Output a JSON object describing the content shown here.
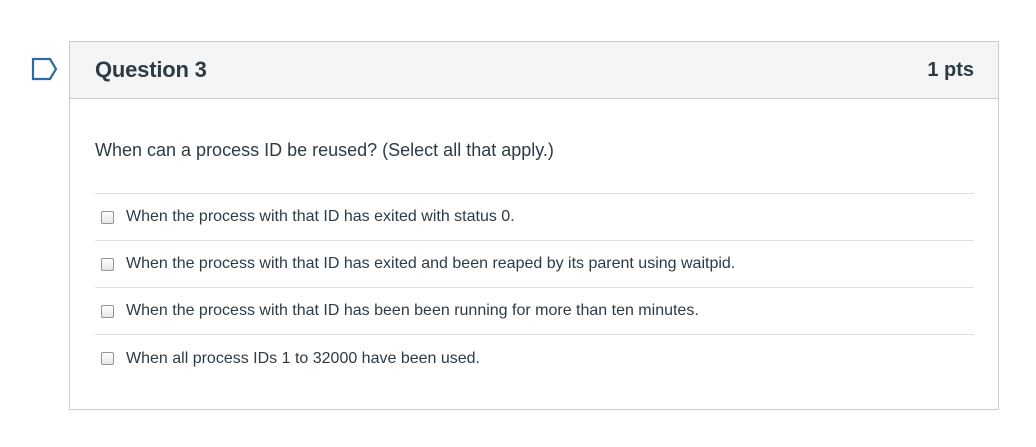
{
  "question": {
    "title": "Question 3",
    "points": "1 pts",
    "text": "When can a process ID be reused?  (Select all that apply.)"
  },
  "answers": [
    {
      "label": "When the process with that ID has exited with status 0.",
      "checked": false
    },
    {
      "label": "When the process with that ID has exited and been reaped by its parent using waitpid.",
      "checked": false
    },
    {
      "label": "When the process with that ID has been been running for more than ten minutes.",
      "checked": false
    },
    {
      "label": "When all process IDs 1 to 32000 have been used.",
      "checked": false
    }
  ],
  "icons": {
    "flag": "bookmark-flag-icon"
  },
  "colors": {
    "flag_outline": "#2d6ca2",
    "header_bg": "#f5f5f5",
    "border": "#c7cdd1",
    "text": "#2d3b45"
  }
}
